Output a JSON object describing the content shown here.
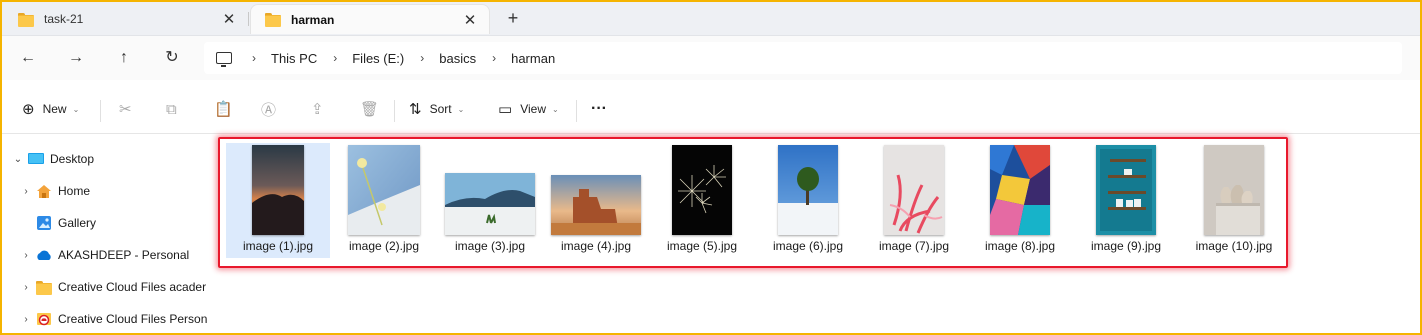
{
  "tabs": [
    {
      "label": "task-21",
      "icon": "folder-icon",
      "active": false
    },
    {
      "label": "harman",
      "icon": "folder-icon",
      "active": true
    }
  ],
  "new_tab_label": "+",
  "nav": {
    "back": "←",
    "forward": "→",
    "up": "↑",
    "refresh": "↻"
  },
  "breadcrumb": [
    "This PC",
    "Files (E:)",
    "basics",
    "harman"
  ],
  "breadcrumb_sep": "›",
  "commands": {
    "new_label": "New",
    "sort_label": "Sort",
    "view_label": "View",
    "more_label": "···"
  },
  "sidebar": {
    "items": [
      {
        "label": "Desktop",
        "icon": "desktop-icon",
        "expanded": true
      },
      {
        "label": "Home",
        "icon": "home-icon"
      },
      {
        "label": "Gallery",
        "icon": "gallery-icon"
      },
      {
        "label": "AKASHDEEP - Personal",
        "icon": "onedrive-icon"
      },
      {
        "label": "Creative Cloud Files  acader",
        "icon": "folder-icon"
      },
      {
        "label": "Creative Cloud Files Person",
        "icon": "creative-cloud-icon"
      }
    ]
  },
  "files": [
    {
      "name": "image (1).jpg",
      "selected": true
    },
    {
      "name": "image (2).jpg"
    },
    {
      "name": "image (3).jpg"
    },
    {
      "name": "image (4).jpg"
    },
    {
      "name": "image (5).jpg"
    },
    {
      "name": "image (6).jpg"
    },
    {
      "name": "image (7).jpg"
    },
    {
      "name": "image (8).jpg"
    },
    {
      "name": "image (9).jpg"
    },
    {
      "name": "image (10).jpg"
    }
  ],
  "colors": {
    "window_border": "#f5b400",
    "highlight": "#e8182c",
    "selection": "#dceafc"
  }
}
